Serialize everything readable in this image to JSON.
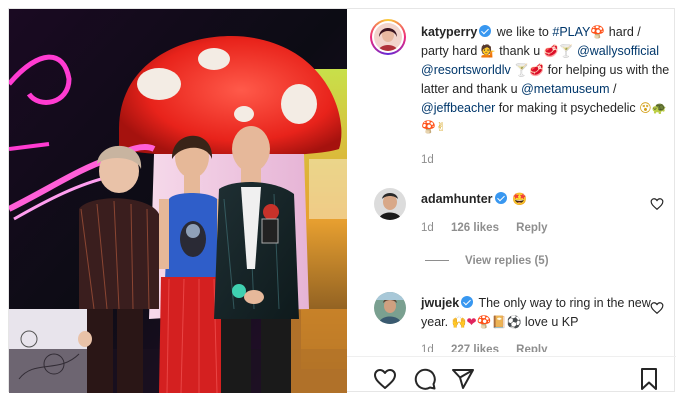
{
  "post": {
    "author": "katyperry",
    "caption_parts": [
      {
        "t": "text",
        "v": "we like to "
      },
      {
        "t": "tag",
        "v": "#PLAY"
      },
      {
        "t": "emo",
        "v": "🍄",
        "c": "emo-red"
      },
      {
        "t": "text",
        "v": " hard / party hard "
      },
      {
        "t": "emo",
        "v": "💁",
        "c": "emo-purple"
      },
      {
        "t": "text",
        "v": " thank u "
      },
      {
        "t": "emo",
        "v": "🥩",
        "c": "emo-red"
      },
      {
        "t": "emo",
        "v": "🍸",
        "c": "emo-gold"
      },
      {
        "t": "text",
        "v": " "
      },
      {
        "t": "tag",
        "v": "@wallysofficial"
      },
      {
        "t": "text",
        "v": " "
      },
      {
        "t": "tag",
        "v": "@resortsworldlv"
      },
      {
        "t": "text",
        "v": " "
      },
      {
        "t": "emo",
        "v": "🍸",
        "c": "emo-gold"
      },
      {
        "t": "emo",
        "v": "🥩",
        "c": "emo-red"
      },
      {
        "t": "text",
        "v": " for helping us with the latter and thank u "
      },
      {
        "t": "tag",
        "v": "@metamuseum"
      },
      {
        "t": "text",
        "v": " / "
      },
      {
        "t": "tag",
        "v": "@jeffbeacher"
      },
      {
        "t": "text",
        "v": " for making it psychedelic "
      },
      {
        "t": "emo",
        "v": "😵",
        "c": "emo-gold"
      },
      {
        "t": "emo",
        "v": "🐢",
        "c": "emo-dark"
      },
      {
        "t": "emo",
        "v": "🍄",
        "c": "emo-red"
      },
      {
        "t": "emo",
        "v": "✌",
        "c": "emo-gold"
      }
    ],
    "age": "1d"
  },
  "comments": [
    {
      "username": "adamhunter",
      "verified": true,
      "text_parts": [
        {
          "t": "emo",
          "v": "🤩",
          "c": "emo-red"
        }
      ],
      "age": "1d",
      "likes": "126 likes",
      "reply_label": "Reply",
      "view_replies": "View replies (5)"
    },
    {
      "username": "jwujek",
      "verified": true,
      "text_parts": [
        {
          "t": "text",
          "v": "The only way to ring in the new year. "
        },
        {
          "t": "emo",
          "v": "🙌",
          "c": "emo-gold"
        },
        {
          "t": "emo",
          "v": "❤",
          "c": "emo-red"
        },
        {
          "t": "emo",
          "v": "🍄",
          "c": "emo-red"
        },
        {
          "t": "emo",
          "v": "📔",
          "c": "emo-dark"
        },
        {
          "t": "emo",
          "v": "⚽",
          "c": "emo-dark"
        },
        {
          "t": "text",
          "v": " love u KP"
        }
      ],
      "age": "1d",
      "likes": "227 likes",
      "reply_label": "Reply"
    }
  ],
  "actions": [
    "heart-icon",
    "comment-icon",
    "share-icon",
    "bookmark-icon"
  ],
  "colors": {
    "link": "#00376b",
    "verified": "#3897f0",
    "muted": "#8e8e8e",
    "text": "#262626"
  }
}
